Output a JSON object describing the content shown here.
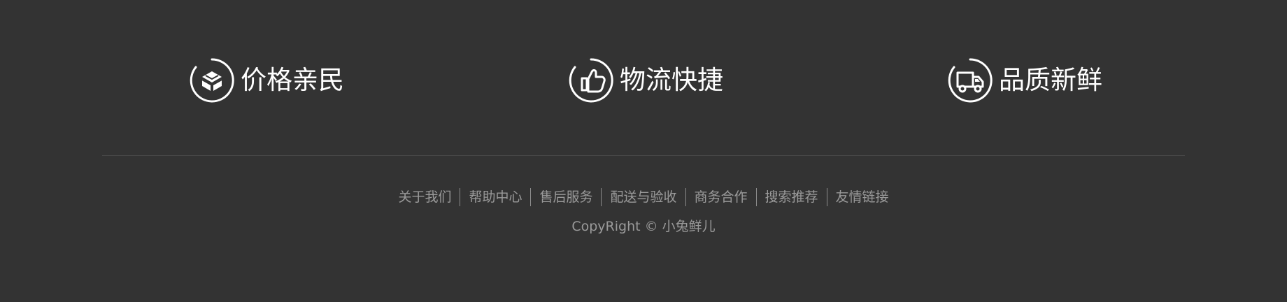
{
  "colors": {
    "background": "#333333",
    "primary_text": "#ffffff",
    "secondary_text": "#9a9a9a",
    "divider": "#474747"
  },
  "features": [
    {
      "label": "价格亲民",
      "icon": "box-icon"
    },
    {
      "label": "物流快捷",
      "icon": "thumbs-up-icon"
    },
    {
      "label": "品质新鲜",
      "icon": "delivery-truck-icon"
    }
  ],
  "links": [
    {
      "label": "关于我们"
    },
    {
      "label": "帮助中心"
    },
    {
      "label": "售后服务"
    },
    {
      "label": "配送与验收"
    },
    {
      "label": "商务合作"
    },
    {
      "label": "搜索推荐"
    },
    {
      "label": "友情链接"
    }
  ],
  "copyright": "CopyRight © 小兔鲜儿"
}
